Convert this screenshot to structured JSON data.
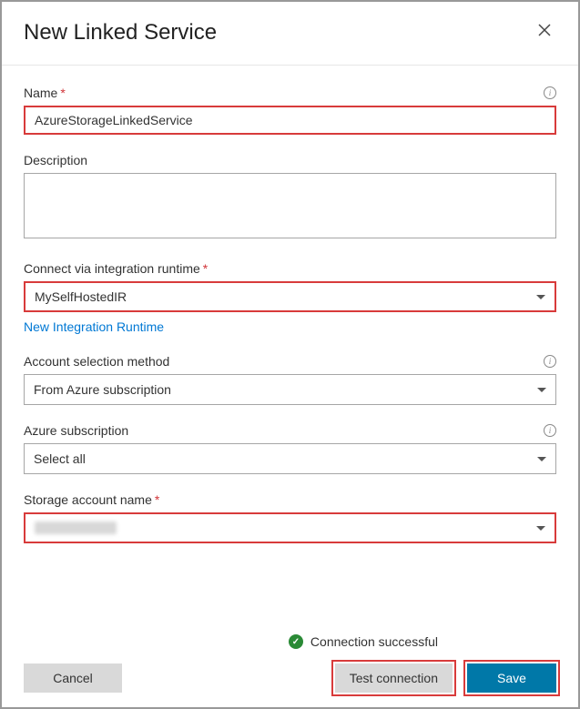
{
  "header": {
    "title": "New Linked Service"
  },
  "fields": {
    "name": {
      "label": "Name",
      "value": "AzureStorageLinkedService"
    },
    "description": {
      "label": "Description",
      "value": ""
    },
    "runtime": {
      "label": "Connect via integration runtime",
      "value": "MySelfHostedIR",
      "new_link": "New Integration Runtime"
    },
    "account_method": {
      "label": "Account selection method",
      "value": "From Azure subscription"
    },
    "subscription": {
      "label": "Azure subscription",
      "value": "Select all"
    },
    "storage_account": {
      "label": "Storage account name",
      "value": ""
    }
  },
  "status": {
    "text": "Connection successful"
  },
  "buttons": {
    "cancel": "Cancel",
    "test": "Test connection",
    "save": "Save"
  }
}
